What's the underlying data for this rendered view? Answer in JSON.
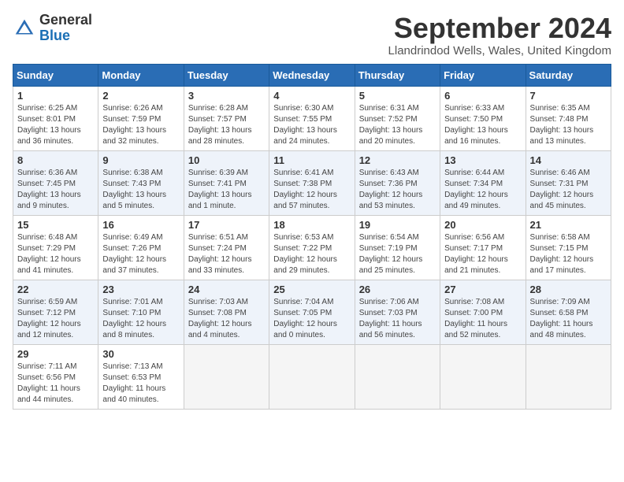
{
  "header": {
    "logo_general": "General",
    "logo_blue": "Blue",
    "month_title": "September 2024",
    "subtitle": "Llandrindod Wells, Wales, United Kingdom"
  },
  "columns": [
    "Sunday",
    "Monday",
    "Tuesday",
    "Wednesday",
    "Thursday",
    "Friday",
    "Saturday"
  ],
  "weeks": [
    [
      {
        "day": "1",
        "sunrise": "Sunrise: 6:25 AM",
        "sunset": "Sunset: 8:01 PM",
        "daylight": "Daylight: 13 hours and 36 minutes."
      },
      {
        "day": "2",
        "sunrise": "Sunrise: 6:26 AM",
        "sunset": "Sunset: 7:59 PM",
        "daylight": "Daylight: 13 hours and 32 minutes."
      },
      {
        "day": "3",
        "sunrise": "Sunrise: 6:28 AM",
        "sunset": "Sunset: 7:57 PM",
        "daylight": "Daylight: 13 hours and 28 minutes."
      },
      {
        "day": "4",
        "sunrise": "Sunrise: 6:30 AM",
        "sunset": "Sunset: 7:55 PM",
        "daylight": "Daylight: 13 hours and 24 minutes."
      },
      {
        "day": "5",
        "sunrise": "Sunrise: 6:31 AM",
        "sunset": "Sunset: 7:52 PM",
        "daylight": "Daylight: 13 hours and 20 minutes."
      },
      {
        "day": "6",
        "sunrise": "Sunrise: 6:33 AM",
        "sunset": "Sunset: 7:50 PM",
        "daylight": "Daylight: 13 hours and 16 minutes."
      },
      {
        "day": "7",
        "sunrise": "Sunrise: 6:35 AM",
        "sunset": "Sunset: 7:48 PM",
        "daylight": "Daylight: 13 hours and 13 minutes."
      }
    ],
    [
      {
        "day": "8",
        "sunrise": "Sunrise: 6:36 AM",
        "sunset": "Sunset: 7:45 PM",
        "daylight": "Daylight: 13 hours and 9 minutes."
      },
      {
        "day": "9",
        "sunrise": "Sunrise: 6:38 AM",
        "sunset": "Sunset: 7:43 PM",
        "daylight": "Daylight: 13 hours and 5 minutes."
      },
      {
        "day": "10",
        "sunrise": "Sunrise: 6:39 AM",
        "sunset": "Sunset: 7:41 PM",
        "daylight": "Daylight: 13 hours and 1 minute."
      },
      {
        "day": "11",
        "sunrise": "Sunrise: 6:41 AM",
        "sunset": "Sunset: 7:38 PM",
        "daylight": "Daylight: 12 hours and 57 minutes."
      },
      {
        "day": "12",
        "sunrise": "Sunrise: 6:43 AM",
        "sunset": "Sunset: 7:36 PM",
        "daylight": "Daylight: 12 hours and 53 minutes."
      },
      {
        "day": "13",
        "sunrise": "Sunrise: 6:44 AM",
        "sunset": "Sunset: 7:34 PM",
        "daylight": "Daylight: 12 hours and 49 minutes."
      },
      {
        "day": "14",
        "sunrise": "Sunrise: 6:46 AM",
        "sunset": "Sunset: 7:31 PM",
        "daylight": "Daylight: 12 hours and 45 minutes."
      }
    ],
    [
      {
        "day": "15",
        "sunrise": "Sunrise: 6:48 AM",
        "sunset": "Sunset: 7:29 PM",
        "daylight": "Daylight: 12 hours and 41 minutes."
      },
      {
        "day": "16",
        "sunrise": "Sunrise: 6:49 AM",
        "sunset": "Sunset: 7:26 PM",
        "daylight": "Daylight: 12 hours and 37 minutes."
      },
      {
        "day": "17",
        "sunrise": "Sunrise: 6:51 AM",
        "sunset": "Sunset: 7:24 PM",
        "daylight": "Daylight: 12 hours and 33 minutes."
      },
      {
        "day": "18",
        "sunrise": "Sunrise: 6:53 AM",
        "sunset": "Sunset: 7:22 PM",
        "daylight": "Daylight: 12 hours and 29 minutes."
      },
      {
        "day": "19",
        "sunrise": "Sunrise: 6:54 AM",
        "sunset": "Sunset: 7:19 PM",
        "daylight": "Daylight: 12 hours and 25 minutes."
      },
      {
        "day": "20",
        "sunrise": "Sunrise: 6:56 AM",
        "sunset": "Sunset: 7:17 PM",
        "daylight": "Daylight: 12 hours and 21 minutes."
      },
      {
        "day": "21",
        "sunrise": "Sunrise: 6:58 AM",
        "sunset": "Sunset: 7:15 PM",
        "daylight": "Daylight: 12 hours and 17 minutes."
      }
    ],
    [
      {
        "day": "22",
        "sunrise": "Sunrise: 6:59 AM",
        "sunset": "Sunset: 7:12 PM",
        "daylight": "Daylight: 12 hours and 12 minutes."
      },
      {
        "day": "23",
        "sunrise": "Sunrise: 7:01 AM",
        "sunset": "Sunset: 7:10 PM",
        "daylight": "Daylight: 12 hours and 8 minutes."
      },
      {
        "day": "24",
        "sunrise": "Sunrise: 7:03 AM",
        "sunset": "Sunset: 7:08 PM",
        "daylight": "Daylight: 12 hours and 4 minutes."
      },
      {
        "day": "25",
        "sunrise": "Sunrise: 7:04 AM",
        "sunset": "Sunset: 7:05 PM",
        "daylight": "Daylight: 12 hours and 0 minutes."
      },
      {
        "day": "26",
        "sunrise": "Sunrise: 7:06 AM",
        "sunset": "Sunset: 7:03 PM",
        "daylight": "Daylight: 11 hours and 56 minutes."
      },
      {
        "day": "27",
        "sunrise": "Sunrise: 7:08 AM",
        "sunset": "Sunset: 7:00 PM",
        "daylight": "Daylight: 11 hours and 52 minutes."
      },
      {
        "day": "28",
        "sunrise": "Sunrise: 7:09 AM",
        "sunset": "Sunset: 6:58 PM",
        "daylight": "Daylight: 11 hours and 48 minutes."
      }
    ],
    [
      {
        "day": "29",
        "sunrise": "Sunrise: 7:11 AM",
        "sunset": "Sunset: 6:56 PM",
        "daylight": "Daylight: 11 hours and 44 minutes."
      },
      {
        "day": "30",
        "sunrise": "Sunrise: 7:13 AM",
        "sunset": "Sunset: 6:53 PM",
        "daylight": "Daylight: 11 hours and 40 minutes."
      },
      null,
      null,
      null,
      null,
      null
    ]
  ]
}
